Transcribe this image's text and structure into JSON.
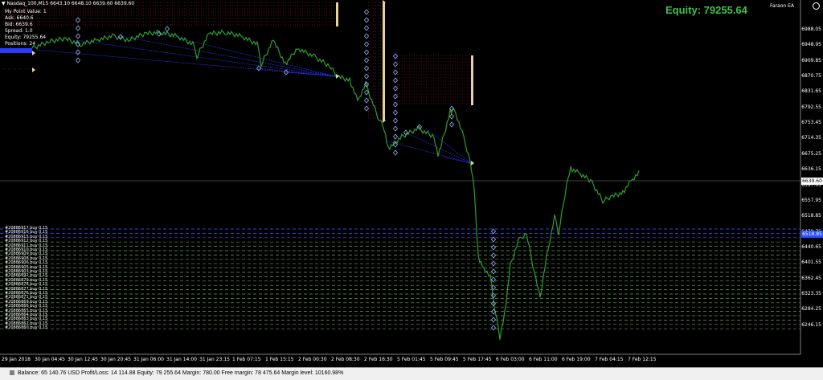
{
  "window": {
    "title": "Nasdaq_100,M15  6643.10 6648.10 6639.60 6639.60",
    "ea_name": "Faraon EA",
    "ea_icon": "smiley-icon"
  },
  "info_panel": {
    "lines": [
      "My Point Value: 1",
      "Ask: 6640.6",
      "Bid: 6639.6",
      "Spread: 1.0",
      "Equity: 79255.64",
      "Positions: 24"
    ]
  },
  "equity_display": "Equity: 79255.64",
  "price_axis": {
    "labels": [
      "6988.05",
      "6948.95",
      "6909.85",
      "6870.75",
      "6831.65",
      "6792.55",
      "6753.45",
      "6714.35",
      "6675.25",
      "6636.15",
      "6597.05",
      "6557.95",
      "6518.85",
      "6479.75",
      "6440.65",
      "6401.55",
      "6362.45",
      "6323.35",
      "6284.25",
      "6246.15"
    ],
    "current_price": "6639.60",
    "highlight_tag": "6518.85"
  },
  "time_axis": {
    "labels": [
      "29 Jan 2018",
      "30 Jan 04:45",
      "30 Jan 12:45",
      "30 Jan 20:45",
      "31 Jan 06:00",
      "31 Jan 14:00",
      "31 Jan 23:15",
      "1 Feb 07:15",
      "1 Feb 15:15",
      "2 Feb 00:30",
      "2 Feb 08:30",
      "2 Feb 16:30",
      "5 Feb 01:45",
      "5 Feb 09:45",
      "5 Feb 17:45",
      "6 Feb 03:00",
      "6 Feb 11:00",
      "6 Feb 19:00",
      "7 Feb 04:15",
      "7 Feb 12:15"
    ]
  },
  "orders": {
    "labels": [
      "#20886917 buy 0.15",
      "#20886916 buy 0.15",
      "#20886915 buy 0.15",
      "#20886912 buy 0.15",
      "#20886911 buy 0.15",
      "#20886910 buy 0.15",
      "#20886909 buy 0.15",
      "#20886908 buy 0.15",
      "#20886906 buy 0.15",
      "#20886905 buy 0.15",
      "#20886903 buy 0.15",
      "#20886892 buy 0.15",
      "#20886879 buy 0.15",
      "#20886878 buy 0.15",
      "#20886877 buy 0.15",
      "#20886876 buy 0.15",
      "#20886871 buy 0.15",
      "#20886869 buy 0.15",
      "#20886866 buy 0.15",
      "#20886865 buy 0.15",
      "#20886864 buy 0.15",
      "#20886863 buy 0.15",
      "#20886862 buy 0.15",
      "#20886860 buy 0.15"
    ]
  },
  "colors": {
    "price_line": "#2f9e2f",
    "equity": "#41c14a",
    "order_line_blue": "#4060ff",
    "order_line_green": "#66a35a",
    "marker": "#9bb0ff",
    "grid_dots": "#8b1a1a"
  },
  "status_bar": {
    "text": "Balance: 65 140.76 USD  Profit/Loss: 14 114.88  Equity: 79 255.64  Margin: 780.00  Free margin: 78 475.64  Margin level: 10160.98%"
  }
}
